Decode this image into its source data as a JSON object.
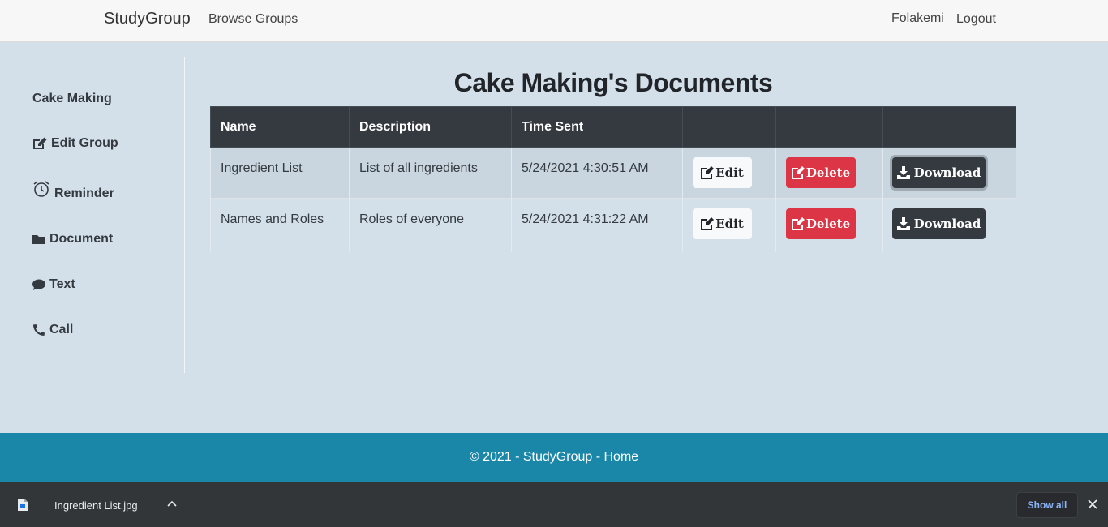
{
  "navbar": {
    "brand": "StudyGroup",
    "browse": "Browse Groups",
    "user": "Folakemi",
    "logout": "Logout"
  },
  "sidebar": {
    "group_name": "Cake Making",
    "items": [
      {
        "label": "Edit Group",
        "icon": "edit-icon"
      },
      {
        "label": "Reminder",
        "icon": "alarm-clock-icon"
      },
      {
        "label": "Document",
        "icon": "folder-icon"
      },
      {
        "label": "Text",
        "icon": "chat-bubble-icon"
      },
      {
        "label": "Call",
        "icon": "phone-icon"
      }
    ]
  },
  "main": {
    "title": "Cake Making's Documents",
    "columns": [
      "Name",
      "Description",
      "Time Sent",
      "",
      "",
      ""
    ],
    "rows": [
      {
        "name": "Ingredient List",
        "description": "List of all ingredients",
        "time": "5/24/2021 4:30:51 AM"
      },
      {
        "name": "Names and Roles",
        "description": "Roles of everyone",
        "time": "5/24/2021 4:31:22 AM"
      }
    ],
    "buttons": {
      "edit": "Edit",
      "delete": "Delete",
      "download": "Download"
    }
  },
  "footer": {
    "text": "© 2021 - StudyGroup - ",
    "link": "Home"
  },
  "download_bar": {
    "file_name": "Ingredient List.jpg",
    "show_all": "Show all"
  },
  "colors": {
    "background": "#d3e0ea",
    "navbar": "#f7f7f7",
    "table_header": "#343a40",
    "delete": "#dc3545",
    "footer": "#1a87a9",
    "download_bar": "#333639"
  }
}
